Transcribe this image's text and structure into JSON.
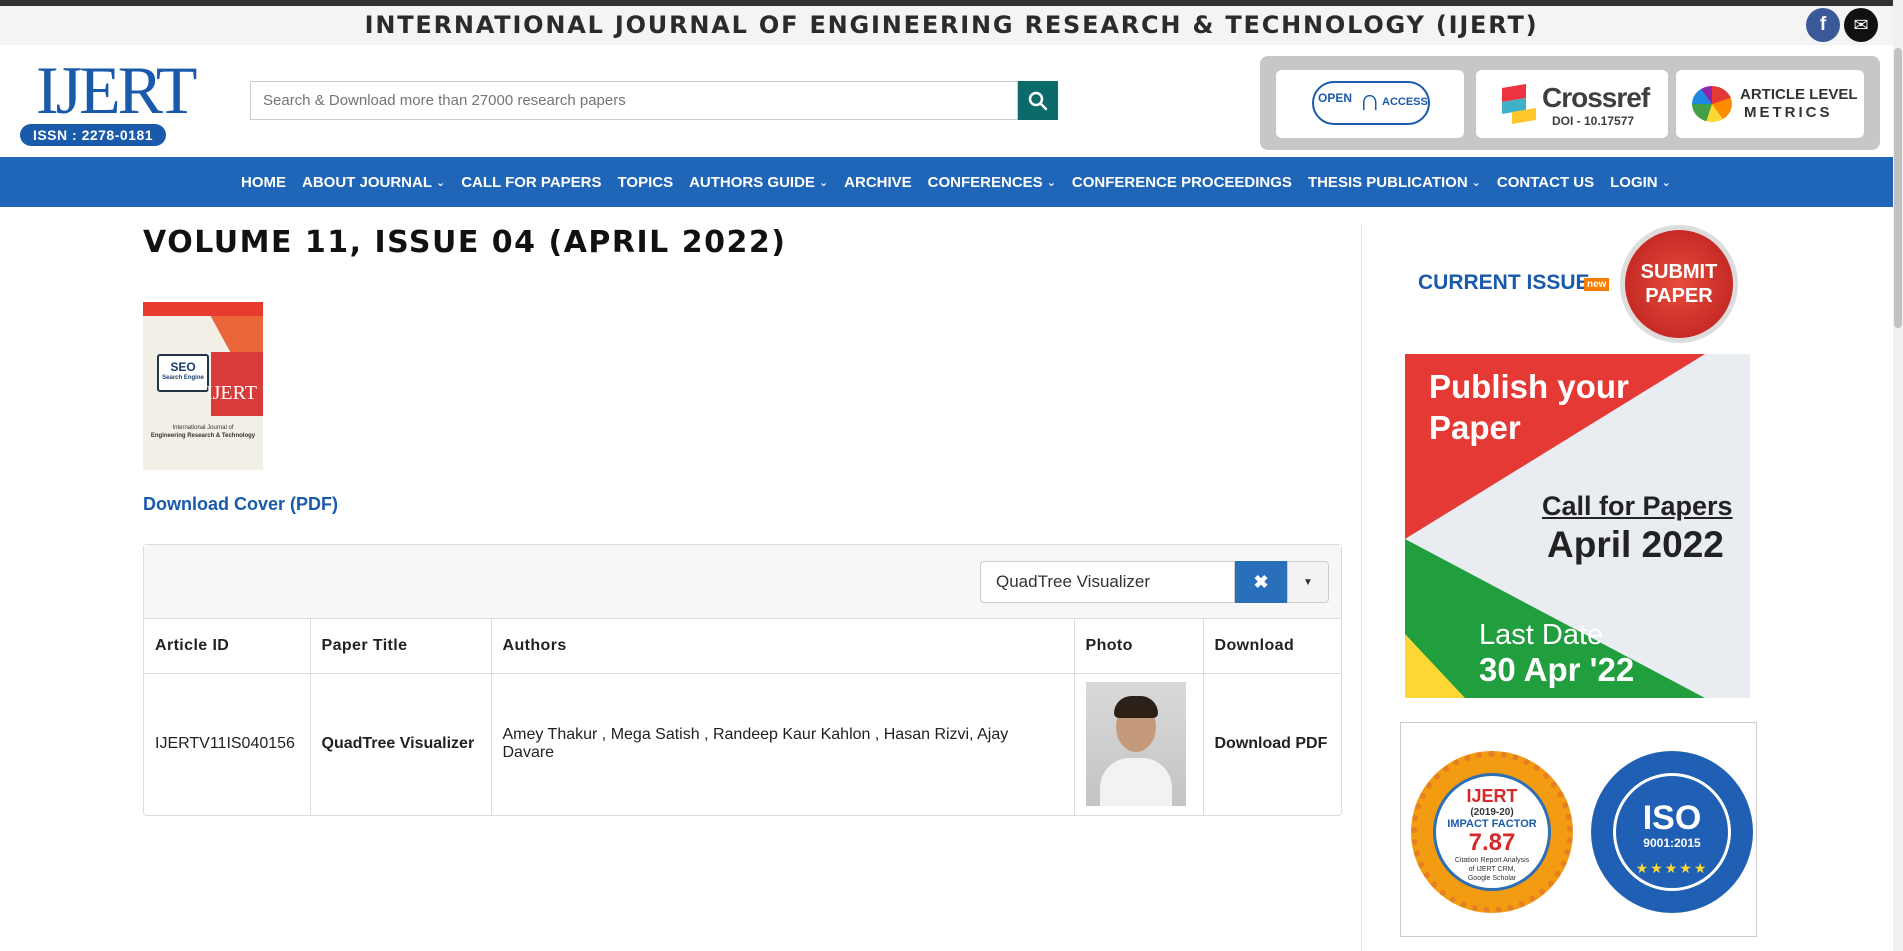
{
  "header": {
    "site_title": "INTERNATIONAL JOURNAL OF ENGINEERING RESEARCH & TECHNOLOGY (IJERT)",
    "social": [
      {
        "name": "facebook-icon",
        "glyph": "f"
      },
      {
        "name": "email-icon",
        "glyph": "✉"
      }
    ],
    "logo_text": "IJERT",
    "issn": "ISSN : 2278-0181",
    "search_placeholder": "Search & Download more than 27000 research papers",
    "badges": {
      "open_access_1": "OPEN",
      "open_access_2": "ACCESS",
      "crossref_name": "Crossref",
      "crossref_doi": "DOI - 10.17577",
      "metrics_1": "ARTICLE LEVEL",
      "metrics_2": "METRICS"
    }
  },
  "nav": {
    "items": [
      {
        "label": "HOME",
        "dropdown": false
      },
      {
        "label": "ABOUT JOURNAL",
        "dropdown": true
      },
      {
        "label": "CALL FOR PAPERS",
        "dropdown": false
      },
      {
        "label": "TOPICS",
        "dropdown": false
      },
      {
        "label": "AUTHORS GUIDE",
        "dropdown": true
      },
      {
        "label": "ARCHIVE",
        "dropdown": false
      },
      {
        "label": "CONFERENCES",
        "dropdown": true
      },
      {
        "label": "CONFERENCE PROCEEDINGS",
        "dropdown": false
      },
      {
        "label": "THESIS PUBLICATION",
        "dropdown": true
      },
      {
        "label": "CONTACT US",
        "dropdown": false
      },
      {
        "label": "LOGIN",
        "dropdown": true
      }
    ]
  },
  "main": {
    "volume_title": "VOLUME 11, ISSUE 04 (APRIL 2022)",
    "cover": {
      "seo_1": "SEO",
      "seo_2": "Search Engine",
      "brand": "IJERT",
      "footer_1": "International Journal of",
      "footer_2": "Engineering Research & Technology"
    },
    "download_cover": "Download Cover (PDF)",
    "filter": {
      "value": "QuadTree Visualizer",
      "clear_glyph": "✖",
      "caret_glyph": "▼"
    },
    "table": {
      "headers": [
        "Article ID",
        "Paper Title",
        "Authors",
        "Photo",
        "Download"
      ],
      "rows": [
        {
          "article_id": "IJERTV11IS040156",
          "title": "QuadTree Visualizer",
          "authors": "Amey Thakur , Mega Satish , Randeep Kaur Kahlon , Hasan Rizvi, Ajay Davare",
          "download": "Download PDF"
        }
      ]
    }
  },
  "sidebar": {
    "current_issue": "CURRENT ISSUE",
    "new_tag": "new",
    "submit_1": "SUBMIT",
    "submit_2": "PAPER",
    "banner": {
      "headline_1": "Publish your",
      "headline_2": "Paper",
      "cfp": "Call for Papers",
      "month": "April 2022",
      "last_date": "Last Date",
      "date": "30 Apr '22"
    },
    "impact_seal": {
      "name": "IJERT",
      "years": "(2019-20)",
      "label": "IMPACT FACTOR",
      "value": "7.87",
      "note_1": "Citation Report Analysis",
      "note_2": "of IJERT CRM,",
      "note_3": "Google Scholar"
    },
    "iso_seal": {
      "title": "ISO",
      "number": "9001:2015",
      "stars": "★★★★★"
    }
  },
  "colors": {
    "nav": "#1f65b8",
    "link": "#1a5aab",
    "search_button": "#0b6b6b",
    "submit": "#d32f2f"
  }
}
